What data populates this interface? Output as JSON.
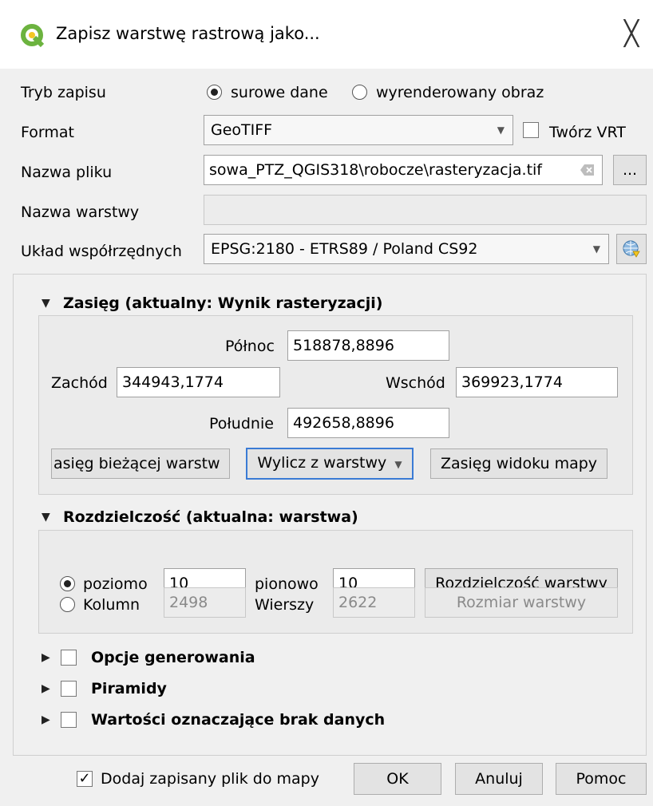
{
  "window": {
    "title": "Zapisz warstwę rastrową jako...",
    "logo_icon": "qgis-logo-icon",
    "close_icon": "close-icon",
    "close_glyph": "╳"
  },
  "form": {
    "mode_label": "Tryb zapisu",
    "mode_raw": "surowe dane",
    "mode_rendered": "wyrenderowany obraz",
    "format_label": "Format",
    "format_value": "GeoTIFF",
    "create_vrt": "Twórz VRT",
    "filename_label": "Nazwa pliku",
    "filename_value": "sowa_PTZ_QGIS318\\robocze\\rasteryzacja.tif",
    "browse": "...",
    "layername_label": "Nazwa warstwy",
    "layername_value": "",
    "crs_label": "Układ współrzędnych",
    "crs_value": "EPSG:2180 - ETRS89 / Poland CS92"
  },
  "extent": {
    "header": "Zasięg (aktualny: Wynik rasteryzacji)",
    "north_label": "Północ",
    "north_value": "518878,8896",
    "west_label": "Zachód",
    "west_value": "344943,1774",
    "east_label": "Wschód",
    "east_value": "369923,1774",
    "south_label": "Południe",
    "south_value": "492658,8896",
    "btn_current": "asięg bieżącej warstw",
    "btn_from_layer": "Wylicz z warstwy",
    "btn_map_view": "Zasięg widoku mapy"
  },
  "resolution": {
    "header": "Rozdzielczość (aktualna: warstwa)",
    "horizontal_label": "poziomo",
    "horizontal_value": "10",
    "vertical_label": "pionowo",
    "vertical_value": "10",
    "btn_layer_res": "Rozdzielczość warstwy",
    "columns_label": "Kolumn",
    "columns_value": "2498",
    "rows_label": "Wierszy",
    "rows_value": "2622",
    "btn_layer_size": "Rozmiar warstwy"
  },
  "sections": {
    "creation_options": "Opcje generowania",
    "pyramids": "Piramidy",
    "nodata": "Wartości oznaczające brak danych"
  },
  "footer": {
    "add_to_map": "Dodaj zapisany plik do mapy",
    "ok": "OK",
    "cancel": "Anuluj",
    "help": "Pomoc"
  },
  "colors": {
    "qgis_green": "#6cb33f",
    "qgis_yellow": "#f3c623",
    "focus_blue": "#3a7bd5"
  }
}
